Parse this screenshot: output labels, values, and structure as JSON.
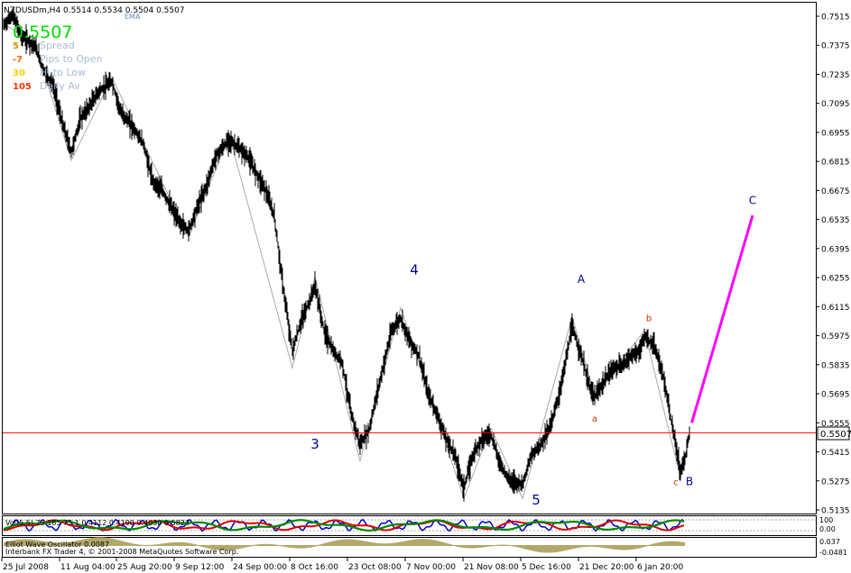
{
  "symbol_header": "NZDUSDm,H4  0.5514 0.5534 0.5504 0.5507",
  "indicator_name": "EMA",
  "current_price_big": "0.5507",
  "info_panel": [
    {
      "value": "5",
      "label": "Spread",
      "color": "#cc9900"
    },
    {
      "value": "-7",
      "label": "Pips to Open",
      "color": "#ff6600"
    },
    {
      "value": "30",
      "label": "Hi to Low",
      "color": "#ffcc00"
    },
    {
      "value": "105",
      "label": "Daily Av",
      "color": "#ff3300"
    }
  ],
  "price_marker": "0.5507",
  "copyright": "Interbank FX Trader 4, © 2001-2008 MetaQuotes Software Corp.",
  "subwindow1": {
    "label": "Vol(5,5) 75.185 75.1 0.4112 0.4190 0.4030 0.5823",
    "axis": [
      "100",
      "0.00"
    ]
  },
  "subwindow2": {
    "label": "Elliot Wave Oscillator 0.0087",
    "axis": [
      "0.037",
      "-0.0481"
    ]
  },
  "colors": {
    "bg": "#ffffff",
    "candles": "#000000",
    "price_line": "#ff0000",
    "wave_line": "#ff00ff",
    "wave_blue": "#000099",
    "wave_orange": "#cc3300",
    "wave_count_lines": "#aaaaaa",
    "ewo_fill": "#b3a86a"
  },
  "chart_data": {
    "type": "candlestick",
    "y_ticks": [
      "0.7515",
      "0.7375",
      "0.7235",
      "0.7095",
      "0.6955",
      "0.6815",
      "0.6675",
      "0.6535",
      "0.6395",
      "0.6255",
      "0.6115",
      "0.5975",
      "0.5835",
      "0.5695",
      "0.5555",
      "0.5415",
      "0.5275",
      "0.5135"
    ],
    "ylim": [
      0.5135,
      0.7515
    ],
    "x_ticks": [
      "25 Jul 2008",
      "11 Aug 04:00",
      "25 Aug 20:00",
      "9 Sep 12:00",
      "24 Sep 00:00",
      "8 Oct 16:00",
      "23 Oct 08:00",
      "7 Nov 00:00",
      "21 Nov 08:00",
      "5 Dec 16:00",
      "21 Dec 20:00",
      "6 Jan 20:00"
    ],
    "current_price": 0.5507,
    "wave_labels": [
      {
        "text": "3",
        "bar": 69,
        "price": 0.543,
        "color": "#000099"
      },
      {
        "text": "4",
        "bar": 91,
        "price": 0.627,
        "color": "#000099"
      },
      {
        "text": "5",
        "bar": 118,
        "price": 0.516,
        "color": "#000099"
      },
      {
        "text": "A",
        "bar": 128,
        "price": 0.623,
        "color": "#000099"
      },
      {
        "text": "a",
        "bar": 131,
        "price": 0.556,
        "color": "#cc3300"
      },
      {
        "text": "b",
        "bar": 143,
        "price": 0.6045,
        "color": "#cc3300"
      },
      {
        "text": "c",
        "bar": 149,
        "price": 0.5255,
        "color": "#cc3300"
      },
      {
        "text": "B",
        "bar": 152,
        "price": 0.5255,
        "color": "#000099"
      },
      {
        "text": "C",
        "bar": 166,
        "price": 0.661,
        "color": "#000099"
      }
    ],
    "projection": {
      "from": {
        "bar": 152.5,
        "price": 0.5555
      },
      "to": {
        "bar": 166,
        "price": 0.6555
      }
    },
    "wave_path": [
      [
        0,
        0.748
      ],
      [
        7,
        0.738
      ],
      [
        15,
        0.682
      ],
      [
        24,
        0.722
      ],
      [
        41,
        0.645
      ],
      [
        50,
        0.694
      ],
      [
        64,
        0.582
      ],
      [
        69,
        0.626
      ],
      [
        79,
        0.537
      ],
      [
        88,
        0.611
      ],
      [
        102,
        0.519
      ],
      [
        108,
        0.553
      ],
      [
        115,
        0.519
      ],
      [
        126,
        0.6065
      ],
      [
        131,
        0.569
      ],
      [
        142,
        0.6
      ],
      [
        150,
        0.529
      ],
      [
        152,
        0.549
      ]
    ],
    "close_path": [
      [
        0,
        0.747
      ],
      [
        2,
        0.752
      ],
      [
        4,
        0.742
      ],
      [
        7,
        0.737
      ],
      [
        9,
        0.725
      ],
      [
        11,
        0.718
      ],
      [
        13,
        0.7
      ],
      [
        15,
        0.686
      ],
      [
        17,
        0.702
      ],
      [
        19,
        0.708
      ],
      [
        21,
        0.715
      ],
      [
        24,
        0.72
      ],
      [
        26,
        0.705
      ],
      [
        28,
        0.7
      ],
      [
        31,
        0.69
      ],
      [
        33,
        0.672
      ],
      [
        35,
        0.668
      ],
      [
        37,
        0.66
      ],
      [
        39,
        0.652
      ],
      [
        41,
        0.648
      ],
      [
        43,
        0.66
      ],
      [
        45,
        0.67
      ],
      [
        47,
        0.684
      ],
      [
        50,
        0.692
      ],
      [
        52,
        0.688
      ],
      [
        54,
        0.684
      ],
      [
        56,
        0.676
      ],
      [
        58,
        0.668
      ],
      [
        60,
        0.655
      ],
      [
        62,
        0.62
      ],
      [
        64,
        0.59
      ],
      [
        66,
        0.605
      ],
      [
        68,
        0.615
      ],
      [
        69,
        0.622
      ],
      [
        71,
        0.6
      ],
      [
        73,
        0.59
      ],
      [
        75,
        0.585
      ],
      [
        77,
        0.56
      ],
      [
        79,
        0.545
      ],
      [
        81,
        0.552
      ],
      [
        83,
        0.572
      ],
      [
        86,
        0.6
      ],
      [
        88,
        0.606
      ],
      [
        90,
        0.595
      ],
      [
        92,
        0.588
      ],
      [
        94,
        0.57
      ],
      [
        96,
        0.56
      ],
      [
        98,
        0.548
      ],
      [
        100,
        0.54
      ],
      [
        102,
        0.524
      ],
      [
        104,
        0.54
      ],
      [
        106,
        0.548
      ],
      [
        108,
        0.55
      ],
      [
        110,
        0.536
      ],
      [
        112,
        0.528
      ],
      [
        115,
        0.526
      ],
      [
        117,
        0.54
      ],
      [
        119,
        0.545
      ],
      [
        121,
        0.553
      ],
      [
        123,
        0.568
      ],
      [
        125,
        0.59
      ],
      [
        126,
        0.602
      ],
      [
        128,
        0.588
      ],
      [
        130,
        0.572
      ],
      [
        131,
        0.568
      ],
      [
        133,
        0.575
      ],
      [
        135,
        0.582
      ],
      [
        137,
        0.583
      ],
      [
        139,
        0.588
      ],
      [
        141,
        0.59
      ],
      [
        142,
        0.597
      ],
      [
        144,
        0.593
      ],
      [
        146,
        0.58
      ],
      [
        148,
        0.556
      ],
      [
        150,
        0.532
      ],
      [
        151,
        0.538
      ],
      [
        152,
        0.551
      ]
    ]
  }
}
